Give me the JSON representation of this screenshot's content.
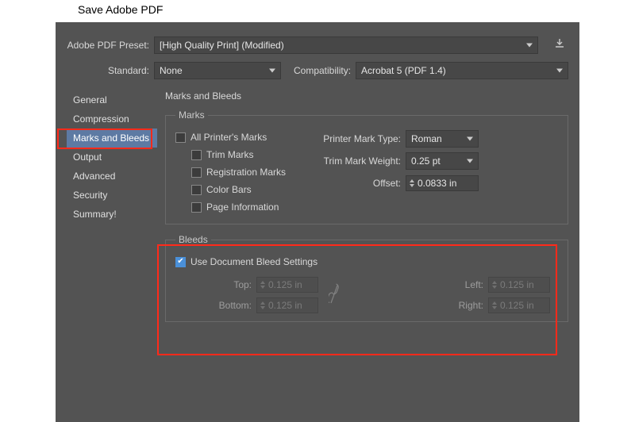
{
  "window": {
    "title": "Save Adobe PDF"
  },
  "preset": {
    "label": "Adobe PDF Preset:",
    "value": "[High Quality Print] (Modified)"
  },
  "standard": {
    "label": "Standard:",
    "value": "None"
  },
  "compatibility": {
    "label": "Compatibility:",
    "value": "Acrobat 5 (PDF 1.4)"
  },
  "sidebar": {
    "items": [
      {
        "label": "General"
      },
      {
        "label": "Compression"
      },
      {
        "label": "Marks and Bleeds"
      },
      {
        "label": "Output"
      },
      {
        "label": "Advanced"
      },
      {
        "label": "Security"
      },
      {
        "label": "Summary!"
      }
    ],
    "active_index": 2
  },
  "panel": {
    "title": "Marks and Bleeds"
  },
  "marks": {
    "legend": "Marks",
    "all_label": "All Printer's Marks",
    "trim_label": "Trim Marks",
    "registration_label": "Registration Marks",
    "colorbars_label": "Color Bars",
    "pageinfo_label": "Page Information",
    "printer_mark_type": {
      "label": "Printer Mark Type:",
      "value": "Roman"
    },
    "trim_mark_weight": {
      "label": "Trim Mark Weight:",
      "value": "0.25 pt"
    },
    "offset": {
      "label": "Offset:",
      "value": "0.0833 in"
    }
  },
  "bleeds": {
    "legend": "Bleeds",
    "use_doc_label": "Use Document Bleed Settings",
    "use_doc_checked": true,
    "top": {
      "label": "Top:",
      "value": "0.125 in"
    },
    "bottom": {
      "label": "Bottom:",
      "value": "0.125 in"
    },
    "left": {
      "label": "Left:",
      "value": "0.125 in"
    },
    "right": {
      "label": "Right:",
      "value": "0.125 in"
    }
  }
}
